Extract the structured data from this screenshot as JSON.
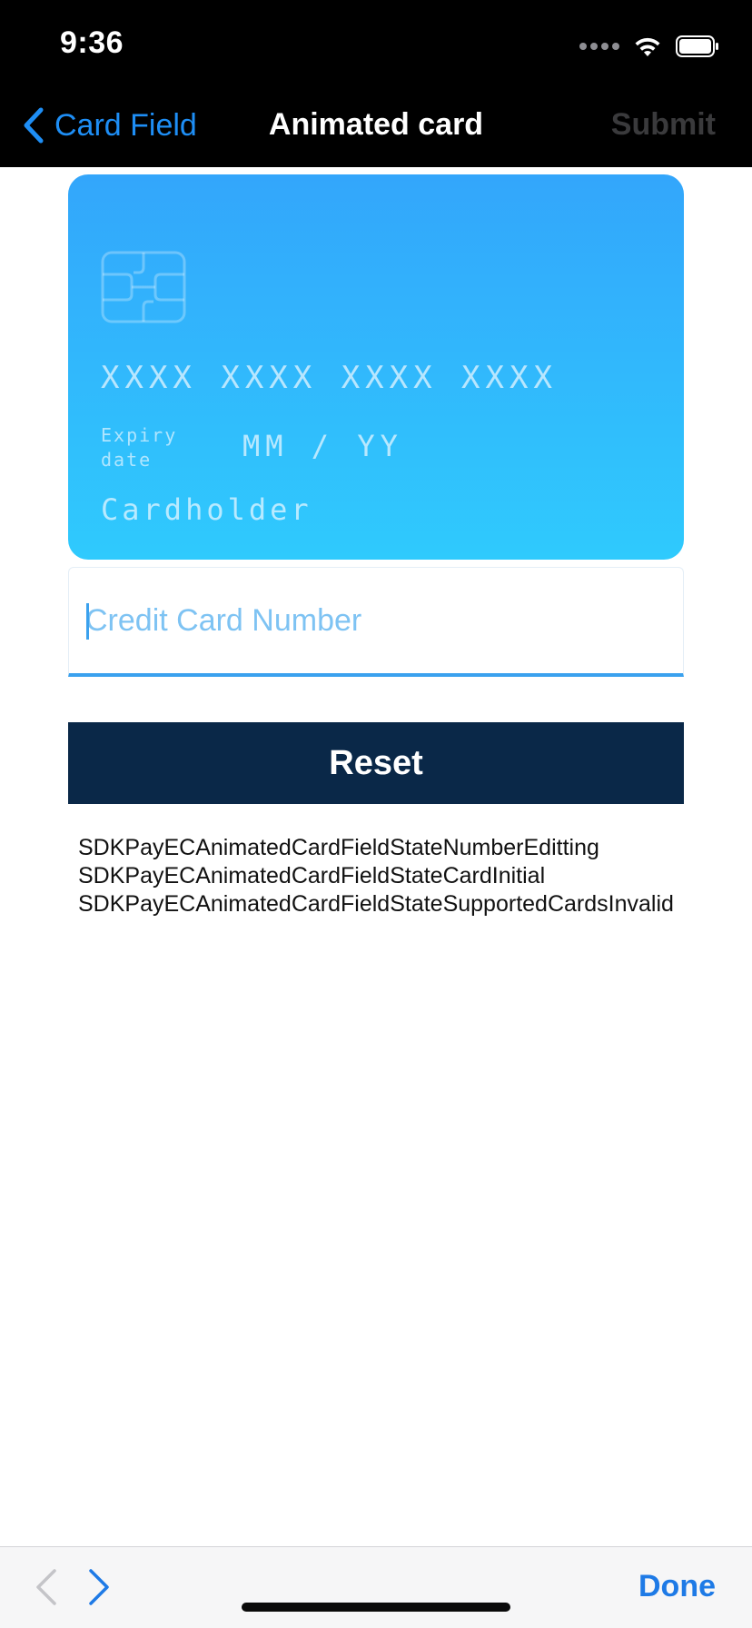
{
  "status_bar": {
    "time": "9:36"
  },
  "nav": {
    "back_label": "Card Field",
    "title": "Animated card",
    "submit_label": "Submit"
  },
  "card": {
    "number_placeholder": "XXXX XXXX XXXX XXXX",
    "expiry_label": "Expiry date",
    "expiry_placeholder": "MM / YY",
    "cardholder_placeholder": "Cardholder"
  },
  "input": {
    "value": "",
    "placeholder": "Credit Card Number"
  },
  "reset_button": {
    "label": "Reset"
  },
  "state_log": [
    "SDKPayECAnimatedCardFieldStateNumberEditting",
    "SDKPayECAnimatedCardFieldStateCardInitial",
    "SDKPayECAnimatedCardFieldStateSupportedCardsInvalid"
  ],
  "keyboard_toolbar": {
    "done_label": "Done"
  },
  "colors": {
    "accent": "#1e8ef5",
    "card_gradient_top": "#33a6fb",
    "card_gradient_bottom": "#2fcafd",
    "reset_background": "#0a2848"
  },
  "icons": {
    "back": "chevron-left-icon",
    "chip": "card-chip-icon",
    "prev": "chevron-left-icon",
    "next": "chevron-right-icon",
    "wifi": "wifi-icon",
    "battery": "battery-icon",
    "signal": "signal-icon"
  }
}
